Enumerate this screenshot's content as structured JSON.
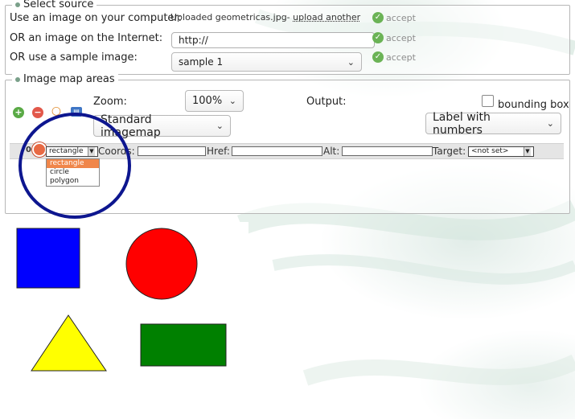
{
  "select_source": {
    "legend": "Select source",
    "rows": [
      {
        "label": "Use an image on your computer:",
        "status_text": "Uploaded geometricas.jpg-",
        "link": "upload another",
        "accept": "accept"
      },
      {
        "label": "OR an image on the Internet:",
        "input_value": "http://",
        "accept": "accept"
      },
      {
        "label": "OR use a sample image:",
        "select_value": "sample 1",
        "accept": "accept"
      }
    ]
  },
  "image_map_areas": {
    "legend": "Image map areas",
    "toolbar": {
      "icons": [
        "add-icon",
        "remove-icon",
        "zoom-icon",
        "preview-icon"
      ],
      "zoom_label": "Zoom:",
      "zoom_value": "100%",
      "output_label": "Output:",
      "bounding_box_label": "bounding box",
      "output_format": "Standard imagemap",
      "label_mode": "Label with numbers"
    },
    "area_row": {
      "index": "0",
      "shape_value": "rectangle",
      "shape_options": [
        "rectangle",
        "circle",
        "polygon"
      ],
      "coords_label": "Coords:",
      "href_label": "Href:",
      "alt_label": "Alt:",
      "target_label": "Target:",
      "target_value": "<not set>"
    }
  },
  "image_shapes": [
    {
      "shape": "square",
      "color": "#0000ff"
    },
    {
      "shape": "circle",
      "color": "#ff0000"
    },
    {
      "shape": "triangle",
      "color": "#ffff00"
    },
    {
      "shape": "rectangle",
      "color": "#008000"
    }
  ],
  "colors": {
    "accept_green": "#6bb356",
    "annotation_circle": "#0d168f",
    "dropdown_highlight": "#f0864a"
  }
}
